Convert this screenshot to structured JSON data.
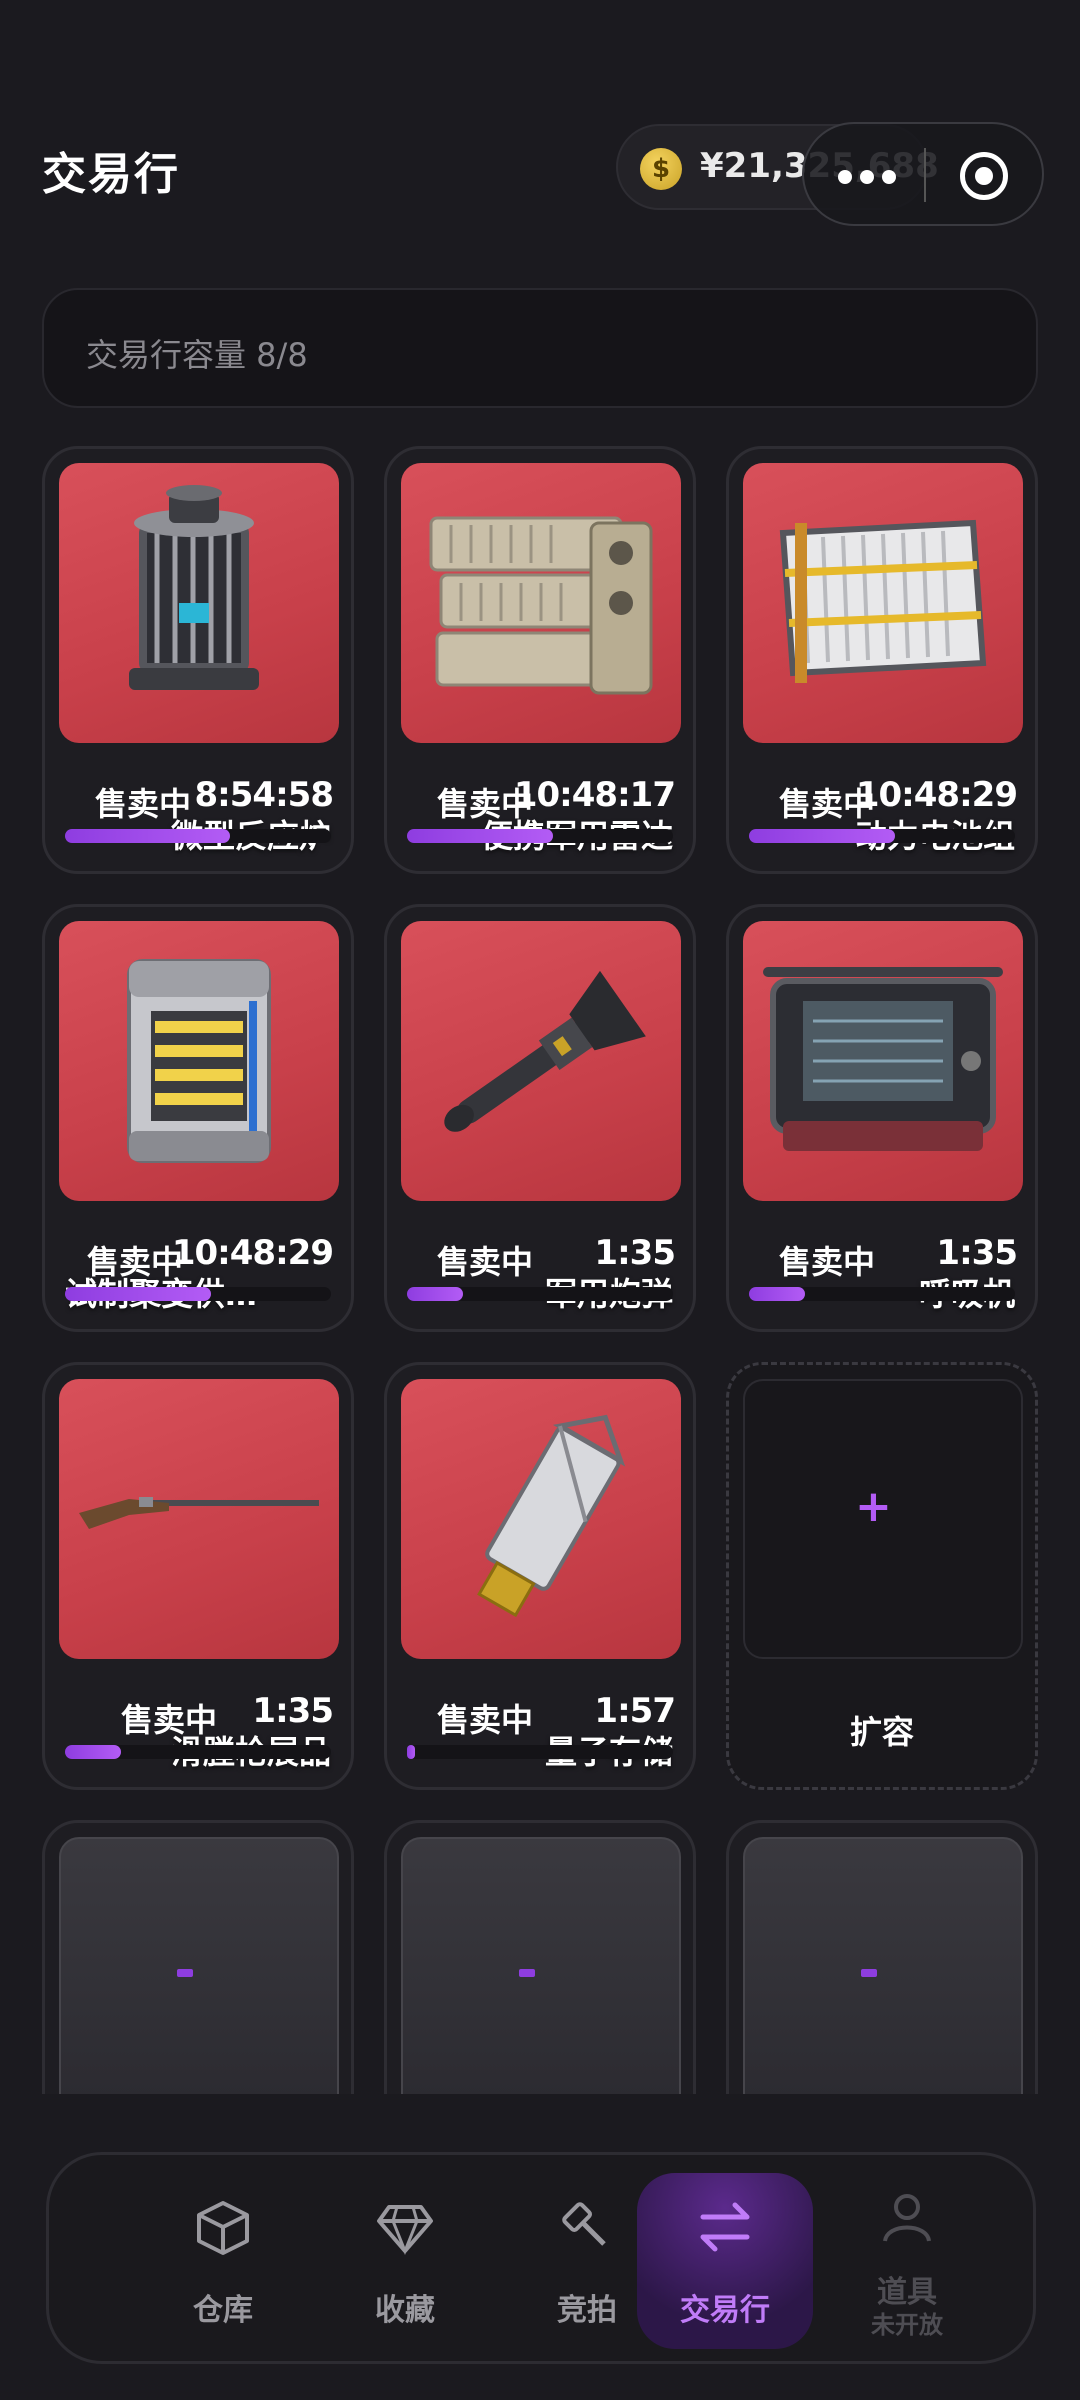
{
  "header": {
    "title": "交易行",
    "balance": "¥21,325,688",
    "coin_symbol": "$"
  },
  "capacity": {
    "text": "交易行容量 8/8"
  },
  "listings": [
    {
      "name": "微型反应炉",
      "status": "售卖中",
      "time": "8:54:58",
      "progress": 0.62
    },
    {
      "name": "便携军用雷达",
      "status": "售卖中",
      "time": "10:48:17",
      "progress": 0.55
    },
    {
      "name": "动力电池组",
      "status": "售卖中",
      "time": "10:48:29",
      "progress": 0.55
    },
    {
      "name": "试制聚变供…",
      "status": "售卖中",
      "time": "10:48:29",
      "progress": 0.55
    },
    {
      "name": "军用炮弹",
      "status": "售卖中",
      "time": "1:35",
      "progress": 0.21
    },
    {
      "name": "呼吸机",
      "status": "售卖中",
      "time": "1:35",
      "progress": 0.21
    },
    {
      "name": "滑膛枪展品",
      "status": "售卖中",
      "time": "1:35",
      "progress": 0.21
    },
    {
      "name": "量子存储",
      "status": "售卖中",
      "time": "1:57",
      "progress": 0.03
    }
  ],
  "expand": {
    "plus": "+",
    "label": "扩容"
  },
  "nav": {
    "items": [
      {
        "label": "仓库",
        "icon": "box-icon"
      },
      {
        "label": "收藏",
        "icon": "diamond-icon"
      },
      {
        "label": "竞拍",
        "icon": "gavel-icon"
      },
      {
        "label": "交易行",
        "icon": "swap-icon"
      },
      {
        "label": "道具",
        "sub": "未开放",
        "icon": "person-icon"
      }
    ]
  },
  "colors": {
    "accent": "#b35cf5",
    "card_art": "#d04a54",
    "background": "#1b1a1f"
  }
}
